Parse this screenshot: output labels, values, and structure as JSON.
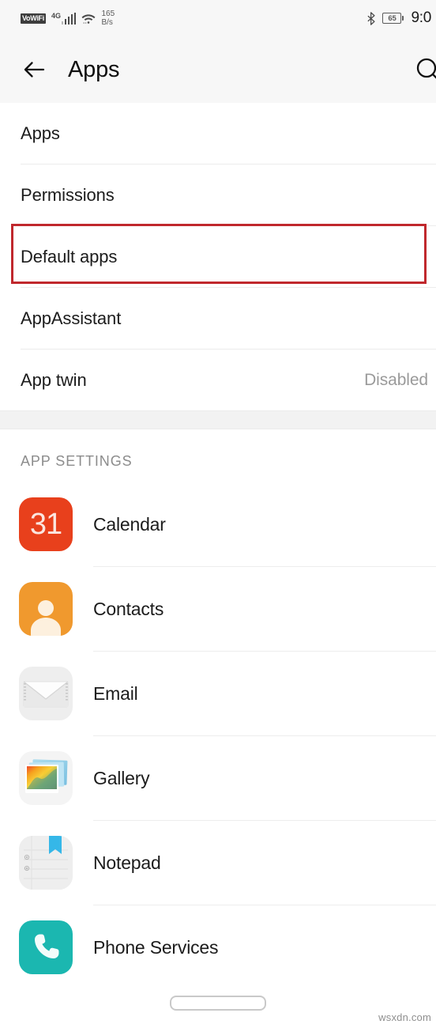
{
  "status_bar": {
    "vowifi_label": "VoWiFi",
    "network_type": "4G",
    "signal_icon": "signal-bars-icon",
    "wifi_icon": "wifi-icon",
    "data_speed_value": "165",
    "data_speed_unit": "B/s",
    "bluetooth_icon": "bluetooth-icon",
    "battery_level": "65",
    "time": "9:0"
  },
  "app_bar": {
    "back_icon": "back-arrow-icon",
    "title": "Apps",
    "search_icon": "search-icon"
  },
  "settings_rows": [
    {
      "label": "Apps",
      "value": ""
    },
    {
      "label": "Permissions",
      "value": ""
    },
    {
      "label": "Default apps",
      "value": "",
      "highlighted": true
    },
    {
      "label": "AppAssistant",
      "value": ""
    },
    {
      "label": "App twin",
      "value": "Disabled"
    }
  ],
  "app_settings": {
    "section_header": "APP SETTINGS",
    "apps": [
      {
        "name": "Calendar",
        "icon": "calendar-icon",
        "icon_badge": "31",
        "color": "#e8401c"
      },
      {
        "name": "Contacts",
        "icon": "contacts-icon",
        "color": "#f0992e"
      },
      {
        "name": "Email",
        "icon": "email-icon",
        "color": "#eeeeee"
      },
      {
        "name": "Gallery",
        "icon": "gallery-icon",
        "color": "#f4f4f4"
      },
      {
        "name": "Notepad",
        "icon": "notepad-icon",
        "color": "#ededed"
      },
      {
        "name": "Phone Services",
        "icon": "phone-icon",
        "color": "#1bb7b0"
      }
    ]
  },
  "annotation": {
    "highlight_color": "#c0282d",
    "target_row": "Default apps"
  },
  "nav_bar": {
    "gesture_pill": "home-gesture-pill"
  },
  "watermark": "wsxdn.com"
}
